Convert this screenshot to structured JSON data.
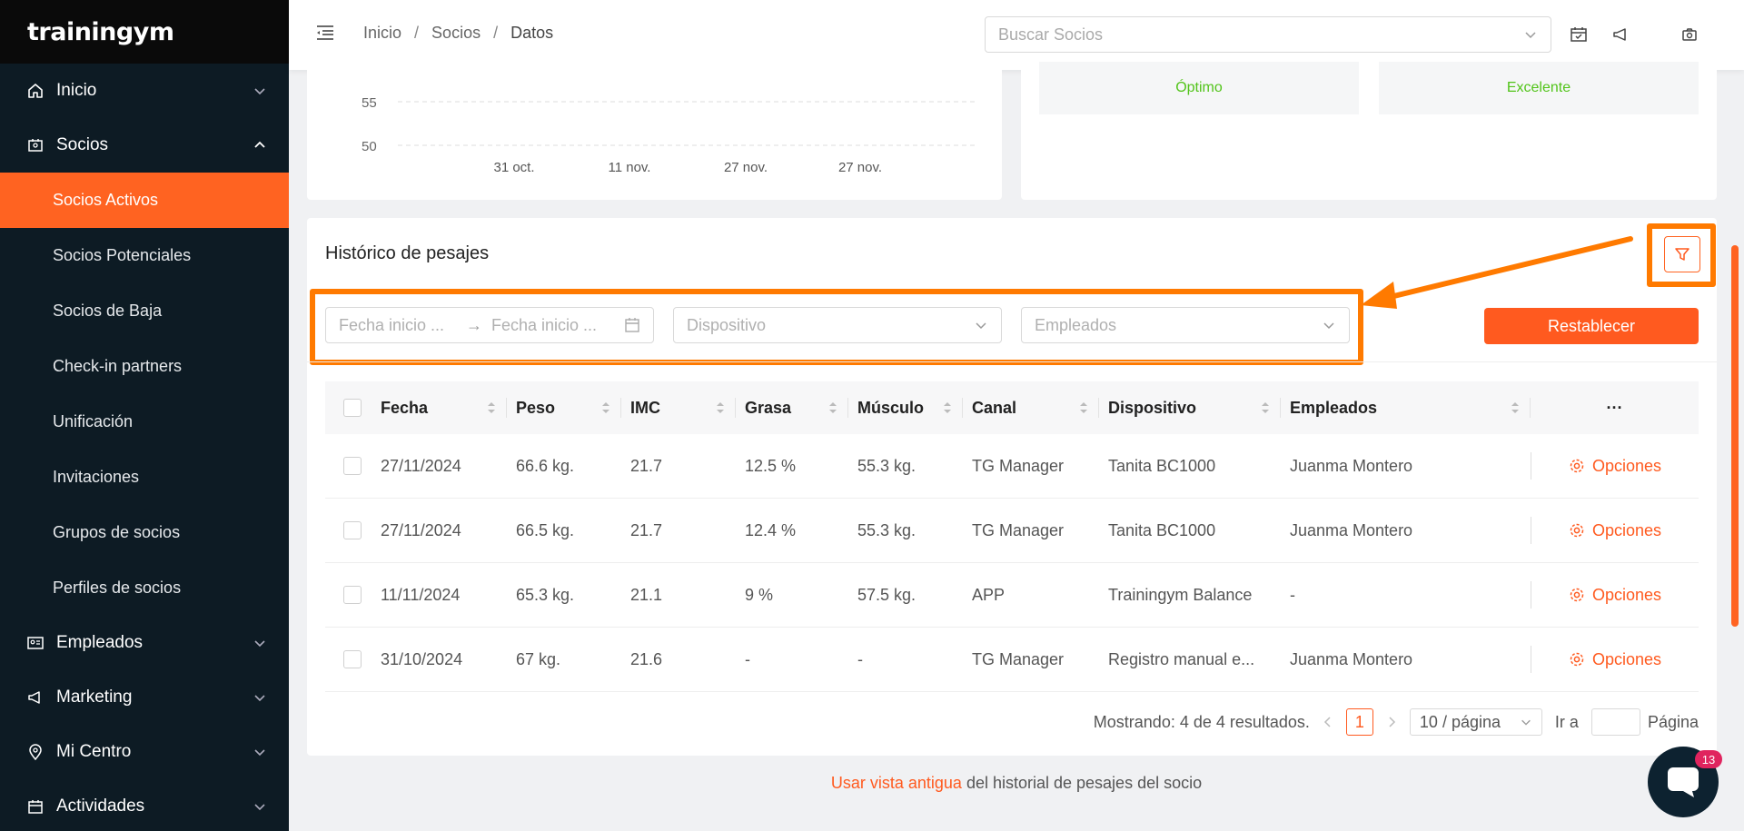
{
  "sidebar": {
    "logo": "trainingym",
    "nav": [
      {
        "label": "Inicio",
        "icon": "home-icon"
      },
      {
        "label": "Socios",
        "icon": "socios-icon"
      }
    ],
    "sub_items": [
      {
        "label": "Socios Activos",
        "active": true
      },
      {
        "label": "Socios Potenciales"
      },
      {
        "label": "Socios de Baja"
      },
      {
        "label": "Check-in partners"
      },
      {
        "label": "Unificación"
      },
      {
        "label": "Invitaciones"
      },
      {
        "label": "Grupos de socios"
      },
      {
        "label": "Perfiles de socios"
      }
    ],
    "nav_bottom": [
      {
        "label": "Empleados",
        "icon": "id-card-icon"
      },
      {
        "label": "Marketing",
        "icon": "megaphone-icon"
      },
      {
        "label": "Mi Centro",
        "icon": "location-pin-icon"
      },
      {
        "label": "Actividades",
        "icon": "calendar-icon"
      }
    ]
  },
  "topbar": {
    "breadcrumb": [
      "Inicio",
      "Socios",
      "Datos"
    ],
    "separator": "/",
    "search_placeholder": "Buscar Socios"
  },
  "chart_data": {
    "type": "line",
    "y_ticks": [
      "55",
      "50"
    ],
    "x_ticks": [
      "31 oct.",
      "11 nov.",
      "27 nov.",
      "27 nov."
    ]
  },
  "status": {
    "left": "Óptimo",
    "right": "Excelente"
  },
  "history": {
    "title": "Histórico de pesajes",
    "date_start_placeholder": "Fecha inicio ...",
    "date_end_placeholder": "Fecha inicio ...",
    "date_arrow": "→",
    "device_placeholder": "Dispositivo",
    "employees_placeholder": "Empleados",
    "reset_label": "Restablecer",
    "columns": [
      "Fecha",
      "Peso",
      "IMC",
      "Grasa",
      "Músculo",
      "Canal",
      "Dispositivo",
      "Empleados"
    ],
    "more_label": "···",
    "options_label": "Opciones",
    "rows": [
      {
        "fecha": "27/11/2024",
        "peso": "66.6 kg.",
        "imc": "21.7",
        "grasa": "12.5 %",
        "musculo": "55.3 kg.",
        "canal": "TG Manager",
        "dispositivo": "Tanita BC1000",
        "empleado": "Juanma Montero"
      },
      {
        "fecha": "27/11/2024",
        "peso": "66.5 kg.",
        "imc": "21.7",
        "grasa": "12.4 %",
        "musculo": "55.3 kg.",
        "canal": "TG Manager",
        "dispositivo": "Tanita BC1000",
        "empleado": "Juanma Montero"
      },
      {
        "fecha": "11/11/2024",
        "peso": "65.3 kg.",
        "imc": "21.1",
        "grasa": "9 %",
        "musculo": "57.5 kg.",
        "canal": "APP",
        "dispositivo": "Trainingym Balance",
        "empleado": "-"
      },
      {
        "fecha": "31/10/2024",
        "peso": "67 kg.",
        "imc": "21.6",
        "grasa": "-",
        "musculo": "-",
        "canal": "TG Manager",
        "dispositivo": "Registro manual e...",
        "empleado": "Juanma Montero"
      }
    ],
    "pagination": {
      "showing": "Mostrando: 4 de 4 resultados.",
      "current_page": "1",
      "page_size": "10 / página",
      "goto_label": "Ir a",
      "page_label": "Página"
    }
  },
  "footer": {
    "link": "Usar vista antigua",
    "text": " del historial de pesajes del socio"
  },
  "chat": {
    "badge": "13"
  },
  "colors": {
    "accent": "#ff5a1f",
    "sidebar_bg": "#0d1b24",
    "success": "#52c41a",
    "highlight": "#ff7a00"
  }
}
